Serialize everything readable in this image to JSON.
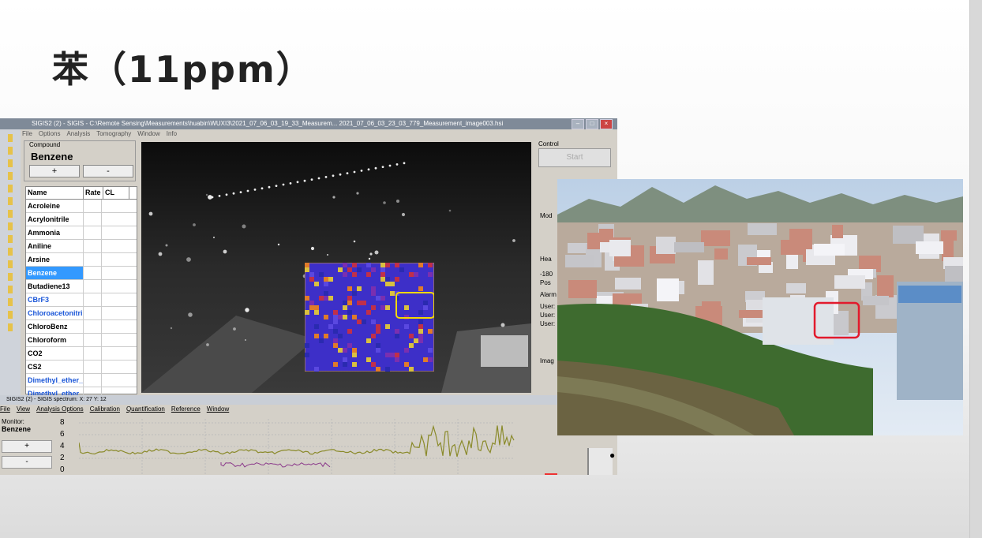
{
  "slide": {
    "title": "苯（11ppm）"
  },
  "sigis_window": {
    "title": "SIGIS2 (2) - SIGIS - C:\\Remote Sensing\\Measurements\\huabin\\WUXI3\\2021_07_06_03_19_33_Measurem... 2021_07_06_03_23_03_779_Measurement_image003.hsi",
    "menu": [
      "File",
      "Options",
      "Analysis",
      "Tomography",
      "Window",
      "Info"
    ],
    "compound_group_label": "Compound",
    "compound_value": "Benzene",
    "plus_label": "+",
    "minus_label": "-",
    "table_headers": [
      "Name",
      "Rate",
      "CL"
    ],
    "table_rows": [
      {
        "name": "Acroleine",
        "state": "normal"
      },
      {
        "name": "Acrylonitrile",
        "state": "normal"
      },
      {
        "name": "Ammonia",
        "state": "normal"
      },
      {
        "name": "Aniline",
        "state": "normal"
      },
      {
        "name": "Arsine",
        "state": "normal"
      },
      {
        "name": "Benzene",
        "state": "selected"
      },
      {
        "name": "Butadiene13",
        "state": "normal"
      },
      {
        "name": "CBrF3",
        "state": "blue"
      },
      {
        "name": "Chloroacetonitri",
        "state": "blue"
      },
      {
        "name": "ChloroBenz",
        "state": "normal"
      },
      {
        "name": "Chloroform",
        "state": "normal"
      },
      {
        "name": "CO2",
        "state": "normal"
      },
      {
        "name": "CS2",
        "state": "normal"
      },
      {
        "name": "Dimethyl_ether_",
        "state": "blue"
      },
      {
        "name": "Dimethyl_ether_",
        "state": "blue"
      }
    ],
    "control_label": "Control",
    "start_label": "Start",
    "side_labels": [
      "Mod",
      "Hea",
      "-180",
      "Pos",
      "Alarm",
      "User:",
      "User:",
      "User:",
      "Imag"
    ]
  },
  "spectrum_window": {
    "title": "SIGIS2 (2) - SIGIS spectrum: X: 27 Y: 12",
    "menu": [
      "File",
      "View",
      "Analysis Options",
      "Calibration",
      "Quantification",
      "Reference",
      "Window"
    ],
    "monitor_label": "Monitor:",
    "monitor_value": "Benzene",
    "plus_label": "+",
    "minus_label": "-",
    "y_ticks": [
      "8",
      "6",
      "4",
      "2",
      "0"
    ]
  },
  "colors": {
    "selection": "#3399ff",
    "highlight_box": "#f5d800",
    "photo_marker": "#e21a2c"
  }
}
